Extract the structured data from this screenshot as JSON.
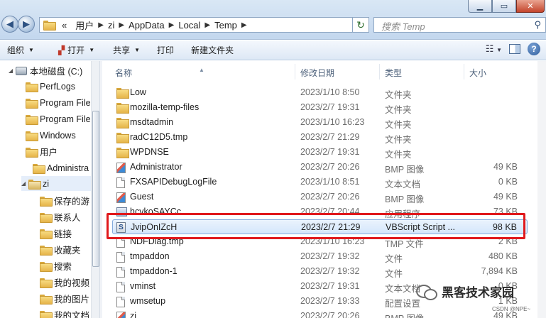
{
  "window": {
    "minimize_icon": "minimize-icon",
    "maximize_icon": "maximize-icon",
    "close_icon": "close-icon"
  },
  "address": {
    "prefix": "«",
    "segments": [
      "用户",
      "zi",
      "AppData",
      "Local",
      "Temp"
    ],
    "search_placeholder": "搜索 Temp"
  },
  "toolbar": {
    "organize": "组织",
    "open": "打开",
    "share": "共享",
    "print": "打印",
    "new_folder": "新建文件夹"
  },
  "nav": {
    "items": [
      {
        "label": "本地磁盘 (C:)"
      },
      {
        "label": "PerfLogs"
      },
      {
        "label": "Program File"
      },
      {
        "label": "Program File"
      },
      {
        "label": "Windows"
      },
      {
        "label": "用户"
      },
      {
        "label": "Administra"
      },
      {
        "label": "zi"
      },
      {
        "label": "保存的游"
      },
      {
        "label": "联系人"
      },
      {
        "label": "链接"
      },
      {
        "label": "收藏夹"
      },
      {
        "label": "搜索"
      },
      {
        "label": "我的视频"
      },
      {
        "label": "我的图片"
      },
      {
        "label": "我的文档"
      }
    ]
  },
  "columns": {
    "name": "名称",
    "date": "修改日期",
    "type": "类型",
    "size": "大小"
  },
  "files": [
    {
      "name": "Low",
      "date": "2023/1/10 8:50",
      "type": "文件夹",
      "size": "",
      "icon": "folder-icon"
    },
    {
      "name": "mozilla-temp-files",
      "date": "2023/2/7 19:31",
      "type": "文件夹",
      "size": "",
      "icon": "folder-icon"
    },
    {
      "name": "msdtadmin",
      "date": "2023/1/10 16:23",
      "type": "文件夹",
      "size": "",
      "icon": "folder-icon"
    },
    {
      "name": "radC12D5.tmp",
      "date": "2023/2/7 21:29",
      "type": "文件夹",
      "size": "",
      "icon": "folder-icon"
    },
    {
      "name": "WPDNSE",
      "date": "2023/2/7 19:31",
      "type": "文件夹",
      "size": "",
      "icon": "folder-icon"
    },
    {
      "name": "Administrator",
      "date": "2023/2/7 20:26",
      "type": "BMP 图像",
      "size": "49 KB",
      "icon": "bmp-image-icon"
    },
    {
      "name": "FXSAPIDebugLogFile",
      "date": "2023/1/10 8:51",
      "type": "文本文档",
      "size": "0 KB",
      "icon": "text-document-icon"
    },
    {
      "name": "Guest",
      "date": "2023/2/7 20:26",
      "type": "BMP 图像",
      "size": "49 KB",
      "icon": "bmp-image-icon"
    },
    {
      "name": "hcvkoSAYCc",
      "date": "2023/2/7 20:44",
      "type": "应用程序",
      "size": "73 KB",
      "icon": "application-icon"
    },
    {
      "name": "JvipOnIZcH",
      "date": "2023/2/7 21:29",
      "type": "VBScript Script ...",
      "size": "98 KB",
      "icon": "vbscript-icon"
    },
    {
      "name": "NDFDiag.tmp",
      "date": "2023/1/10 16:23",
      "type": "TMP 文件",
      "size": "2 KB",
      "icon": "text-document-icon"
    },
    {
      "name": "tmpaddon",
      "date": "2023/2/7 19:32",
      "type": "文件",
      "size": "480 KB",
      "icon": "text-document-icon"
    },
    {
      "name": "tmpaddon-1",
      "date": "2023/2/7 19:32",
      "type": "文件",
      "size": "7,894 KB",
      "icon": "text-document-icon"
    },
    {
      "name": "vminst",
      "date": "2023/2/7 19:31",
      "type": "文本文档",
      "size": "0 KB",
      "icon": "text-document-icon"
    },
    {
      "name": "wmsetup",
      "date": "2023/2/7 19:33",
      "type": "配置设置",
      "size": "1 KB",
      "icon": "text-document-icon"
    },
    {
      "name": "zi",
      "date": "2023/2/7 20:26",
      "type": "BMP 图像",
      "size": "49 KB",
      "icon": "bmp-image-icon"
    }
  ],
  "selected_file_index": 9,
  "highlight_color": "#e0191c",
  "watermark": {
    "text": "黑客技术家园",
    "credit": "CSDN @NPE~"
  }
}
